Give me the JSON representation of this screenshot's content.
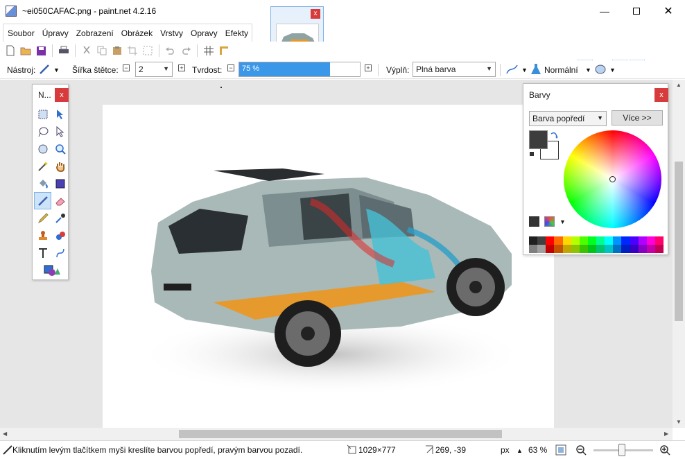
{
  "window": {
    "title": "~ei050CAFAC.png - paint.net 4.2.16"
  },
  "menu": [
    "Soubor",
    "Úpravy",
    "Zobrazení",
    "Obrázek",
    "Vrstvy",
    "Opravy",
    "Efekty"
  ],
  "toolbar": {
    "tool_label": "Nástroj:",
    "brush_width_label": "Šířka štětce:",
    "brush_width_value": "2",
    "hardness_label": "Tvrdost:",
    "hardness_value": "75 %",
    "hardness_fraction": 0.75,
    "fill_label": "Výplň:",
    "fill_value": "Plná barva",
    "blend_value": "Normální"
  },
  "tools_window": {
    "title": "N...",
    "close": "x"
  },
  "colors_window": {
    "title": "Barvy",
    "close": "x",
    "mode": "Barva popředí",
    "more_button": "Více >>",
    "primary_color": "#3d3d3d",
    "secondary_color": "#ffffff"
  },
  "palette_top": [
    "#202020",
    "#404040",
    "#ff0000",
    "#ff6a00",
    "#ffd800",
    "#b6ff00",
    "#4cff00",
    "#00ff21",
    "#00ff90",
    "#00ffff",
    "#0094ff",
    "#0026ff",
    "#4800ff",
    "#b200ff",
    "#ff00dc",
    "#ff006e"
  ],
  "palette_bottom": [
    "#808080",
    "#a0a0a0",
    "#c40000",
    "#c45200",
    "#c4a600",
    "#8cc400",
    "#3ac400",
    "#00c41a",
    "#00c46e",
    "#00c4c4",
    "#0072c4",
    "#001ec4",
    "#3800c4",
    "#8800c4",
    "#c400aa",
    "#c40054"
  ],
  "status": {
    "hint": "Kliknutím levým tlačítkem myši kreslíte barvou popředí, pravým barvou pozadí.",
    "image_size": "1029×777",
    "cursor_pos": "269, -39",
    "units": "px",
    "zoom": "63 %"
  },
  "colors": {
    "accent": "#3b97e8",
    "close_red": "#d83b3b"
  }
}
